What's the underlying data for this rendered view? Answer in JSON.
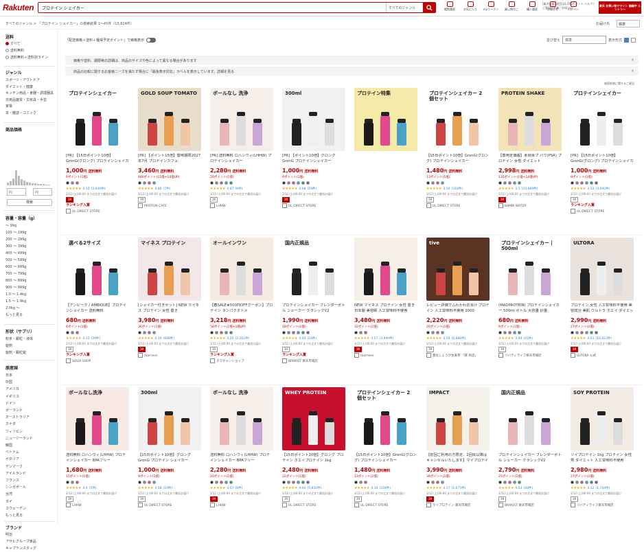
{
  "header": {
    "logo": "Rakuten",
    "search_value": "プロテイン シェイカー",
    "genre_label": "すべてのジャンル",
    "icons": [
      {
        "label": "閲覧履歴",
        "icon": "history-icon"
      },
      {
        "label": "お気に入り",
        "icon": "heart-icon"
      },
      {
        "label": "myクーポン",
        "icon": "coupon-icon"
      },
      {
        "label": "買い物かご",
        "icon": "cart-icon"
      },
      {
        "label": "購入履歴",
        "icon": "receipt-icon"
      },
      {
        "label": "お知らせ",
        "icon": "bell-icon"
      },
      {
        "label": "ログイン",
        "icon": "user-icon"
      }
    ],
    "points_text": "[楽天会員] 初回は1,000ポイント ヘルプ / ご意見目安箱 / お知らせ",
    "banner_text": "楽天 お買い物マラソン 開催中 エントリー"
  },
  "crumb": {
    "text": "すべてのジャンル > 「プロテイン シェイカー」の検索結果 1〜45件（15,624件）",
    "location": "お届け先",
    "sort_label": "標準"
  },
  "sidebar": {
    "shipping_title": "送料",
    "shipping_options": [
      "すべて",
      "送料無料",
      "送料無料＋送料別ライン"
    ],
    "genre_title": "ジャンル",
    "genres": [
      "スポーツ・アウトドア",
      "ダイエット・健康",
      "キッチン用品・食器・調理器具",
      "日用品雑貨・文房具・手芸",
      "家電",
      "本・雑誌・コミック"
    ],
    "price_title": "商品価格",
    "price_from": "円",
    "price_to": "円",
    "search_btn": "検索",
    "capacity_title": "容量・容量（g）",
    "capacities": [
      "〜 99g",
      "100 〜 199g",
      "200 〜 299g",
      "300 〜 399g",
      "400 〜 499g",
      "500 〜 599g",
      "600 〜 699g",
      "700 〜 799g",
      "800 〜 899g",
      "900 〜 999g",
      "1.0 〜 1.4kg",
      "1.5 〜 1.9kg",
      "2.0kg 〜",
      "もっと見る"
    ],
    "type_title": "形状（サプリ）",
    "types": [
      "粉末・顆粒・液体",
      "錠剤",
      "錠剤・顆粒錠"
    ],
    "origin_title": "原産国",
    "origins": [
      "日本",
      "中国",
      "アメリカ",
      "イギリス",
      "ドイツ",
      "ポーランド",
      "オーストラリア",
      "カナダ",
      "フィリピン",
      "ニュージーランド",
      "韓国",
      "ベトナム",
      "イタリア",
      "デンマーク",
      "アイルランド",
      "フランス",
      "シンガポール",
      "台湾",
      "タイ",
      "スウェーデン",
      "もっと見る"
    ],
    "brand_title": "ブランド",
    "brands": [
      "明治",
      "アサヒグループ食品",
      "キャプテンスタッグ"
    ]
  },
  "main": {
    "point_toggle_label": "「配送価格＋送料＋獲得予定ポイント」で価格表示",
    "view_label": "並び替え",
    "sort_value": "標準",
    "view_type": "表示形式",
    "notices": [
      "価格や送料、期限等の詳細は、商品のサイズや色によって異なる場合があります",
      "商品の比較に関するお客様ニーズを満たす場合に「最後表示対応」ラベルを表示しています。詳細を見る"
    ],
    "feedback": "検索結果に関するご意見"
  },
  "products": [
    {
      "title": "[PR] 【15日ポイント10倍】GronG(グロング) プロテインシェイカー",
      "price": "1,000",
      "points": "9ポイント(1倍)",
      "rating": "4.33",
      "reviews": "(3,040件)",
      "shop": "UL DIRECT STORE",
      "rank": "ランキング入賞",
      "tag": "プロテインシェイカー",
      "bg": "#ffffff"
    },
    {
      "title": "[PR] 【ポイント15倍】賞味期限2027年7月 プロテインカフェ",
      "price": "3,460",
      "points": "480ポイント(15倍+14倍UP)",
      "rating": "4.86",
      "reviews": "(7件)",
      "shop": "PROTEIN CAFE",
      "rank": "",
      "tag": "GOLD SOUP TOMATO",
      "bg": "#e8dccb"
    },
    {
      "title": "[PR] 送料無料 ロハンウィ(LHHW) プロテインシェイカー",
      "price": "2,280",
      "points": "20ポイント(1倍)",
      "rating": "4.67",
      "reviews": "(6件)",
      "shop": "LHHW",
      "rank": "",
      "tag": "ボールなし 洗浄",
      "bg": "#f6eee9"
    },
    {
      "title": "[PR] 【ポイント10倍】グロング GronG プロテインシェイカー",
      "price": "1,000",
      "points": "9ポイント(1倍)",
      "rating": "4.68",
      "reviews": "(19件)",
      "shop": "UL DIRECT STORE",
      "rank": "",
      "tag": "300ml",
      "bg": "#f1f1f1"
    },
    {
      "title": "",
      "price": "",
      "points": "",
      "rating": "",
      "reviews": "",
      "shop": "",
      "rank": "",
      "tag": "プロテイン特集",
      "bg": "#f5e9a8"
    },
    {
      "title": "【15日ポイント10倍】GronG(グロング) プロテインシェイカー",
      "price": "1,480",
      "points": "13ポイント(1倍)",
      "rating": "4.34",
      "reviews": "(318件)",
      "shop": "UL DIRECT STORE",
      "rank": "",
      "tag": "プロテインシェイカー 2個セット",
      "bg": "#ffffff"
    },
    {
      "title": "【専用定価版】未目目プ バウ(PSR) プロテイン 女性 ダイエット",
      "price": "2,998",
      "points": "135ポイント(1倍+14倍UP)",
      "rating": "4.5",
      "reviews": "(33,889件)",
      "shop": "BAMBI WATER",
      "rank": "",
      "tag": "PROTEIN SHAKE",
      "bg": "#f3e3b8"
    },
    {
      "title": "[PR] 【15日ポイント10倍】GronG(グロング) プロテインシェイカー",
      "price": "1,000",
      "points": "9ポイント(1倍)",
      "rating": "4.33",
      "reviews": "(3,040件)",
      "shop": "UL DIRECT STORE",
      "rank": "ランキング入賞",
      "tag": "プロテインシェイカー",
      "bg": "#ffffff"
    },
    {
      "title": "【アンビーク / AMBIQUE】プロテインシェイカー 送料無料",
      "price": "680",
      "points": "6ポイント(1倍)",
      "rating": "4.31",
      "reviews": "(39件)",
      "shop": "SOLIA SHOP",
      "rank": "ランキング入賞",
      "tag": "選べる2サイズ",
      "bg": "#ffffff"
    },
    {
      "title": "[シェイカー付きセット] NEW マイネス プロテイン 女性 置き",
      "price": "3,980",
      "points": "36ポイント(1倍)",
      "rating": "4.36",
      "reviews": "(668件)",
      "shop": "marness",
      "rank": "",
      "tag": "マイネス プロテイン",
      "bg": "#f3e6e6"
    },
    {
      "title": "【春SALE★500円OFFクーポン】プロテイン タンパクオトメ",
      "price": "3,218",
      "points": "58ポイント(1倍+1倍UP)",
      "rating": "4.25",
      "reviews": "(2,262件)",
      "shop": "タマチャンショップ",
      "rank": "ランキング入賞",
      "tag": "オールインワン",
      "bg": "#f4ece0"
    },
    {
      "title": "プロテインシェイカー ブレンダーボトル シェーカー クラシックV2",
      "price": "1,990",
      "points": "18ポイント(1倍)",
      "rating": "4.43",
      "reviews": "(54件)",
      "shop": "BRAKIST 楽天市場店",
      "rank": "ランキング入賞",
      "tag": "国内正規品",
      "bg": "#ffffff"
    },
    {
      "title": "NEW マイネス プロテイン 女性 置き 日本製 美容師 人工甘味料不使用",
      "price": "3,480",
      "points": "32ポイント(1倍)",
      "rating": "4.57",
      "reviews": "(3,990件)",
      "shop": "marness",
      "rank": "",
      "tag": "",
      "bg": "#f5efe8"
    },
    {
      "title": "レビュー評価でふわかわおまけ プロテイン 人工甘味料不使用 2000",
      "price": "2,220",
      "points": "20ポイント(1倍)",
      "rating": "4.56",
      "reviews": "(6,886件)",
      "shop": "豊化しょうが生姜茶 「麻 商店」",
      "rank": "",
      "tag": "tive",
      "bg": "#5a3322"
    },
    {
      "title": "(MADPROTEIN) プロテインシェイカー 500ml ボトル 大容量 計量",
      "price": "680",
      "points": "6ポイント(1倍)",
      "rating": "3.94",
      "reviews": "(41件)",
      "shop": "リバティライフ楽天市場店",
      "rank": "",
      "tag": "プロテインシェイカー | 500ml",
      "bg": "#ffffff"
    },
    {
      "title": "プロテイン 女性 人工甘味料不使用 美容成分 美肌 ウルトラ ホエイ ダイエット",
      "price": "2,990",
      "points": "27ポイント(1倍)",
      "rating": "4.61",
      "reviews": "(10,823件)",
      "shop": "ULTORA 公式",
      "rank": "",
      "tag": "ULTORA",
      "bg": "#e9e1dc"
    },
    {
      "title": "送料無料 ロハンウィ(LHHW) プロテインシェイカー BPAフリー",
      "price": "1,680",
      "points": "15ポイント(1倍)",
      "rating": "4.4",
      "reviews": "(5件)",
      "shop": "LHHW",
      "rank": "",
      "tag": "ボールなし洗浄",
      "bg": "#f7e9e3"
    },
    {
      "title": "【15日ポイント10倍】グロング GronG プロテイン シェイカー",
      "price": "1,000",
      "points": "9ポイント(1倍)",
      "rating": "4.68",
      "reviews": "(19件)",
      "shop": "UL DIRECT STORE",
      "rank": "",
      "tag": "300ml",
      "bg": "#f1f1f1"
    },
    {
      "title": "送料無料 ロハンウィ(LHHW) プロテインシェイカー BPAフリー",
      "price": "2,280",
      "points": "20ポイント(1倍)",
      "rating": "4.67",
      "reviews": "(6件)",
      "shop": "LHHW",
      "rank": "",
      "tag": "ボールなし 洗浄",
      "bg": "#f6eee9"
    },
    {
      "title": "【15日ポイント10倍】グロング プロテイン ホエイプロテイン 1kg",
      "price": "2,480",
      "points": "22ポイント(1倍)",
      "rating": "4.44",
      "reviews": "(5,830件)",
      "shop": "UL DIRECT STORE",
      "rank": "",
      "tag": "WHEY PROTEIN",
      "bg": "#c8102e"
    },
    {
      "title": "【15日ポイント10倍】GronG(グロング) プロテインシェイカー",
      "price": "1,480",
      "points": "13ポイント(1倍)",
      "rating": "4.34",
      "reviews": "(318件)",
      "shop": "UL DIRECT STORE",
      "rank": "",
      "tag": "プロテインシェイカー 2個セット",
      "bg": "#ffffff"
    },
    {
      "title": "【初回ご利用の方限定、2回目以降はキャンセルいたします】マイプロテイン",
      "price": "3,990",
      "points": "39ポイント(1倍)",
      "rating": "4.17",
      "reviews": "(1,675件)",
      "shop": "マイプロテイン 楽天市場店",
      "rank": "",
      "tag": "IMPACT",
      "bg": "#f4f0ea"
    },
    {
      "title": "プロテインシェイカー ブレンダーボトル シェーカー クラシックV2",
      "price": "2,790",
      "points": "25ポイント(1倍)",
      "rating": "4.63",
      "reviews": "(48件)",
      "shop": "BRAKIST 楽天市場店",
      "rank": "",
      "tag": "国内正規品",
      "bg": "#ffffff"
    },
    {
      "title": "ソイプロテイン 1kg プロテイン 女性 男 ダイエット 人工甘味料不使用",
      "price": "2,980",
      "points": "27ポイント(1倍)",
      "rating": "4.32",
      "reviews": "(1,744件)",
      "shop": "リバティライフ楽天市場店",
      "rank": "",
      "tag": "SOY PROTEIN",
      "bg": "#f2ece4"
    }
  ],
  "labels": {
    "free_shipping": "送料無料",
    "yen": "円",
    "shipping_note": "3/12 (土)00:00 までの注文で最短お届け"
  },
  "colors": {
    "accent": "#bf0000",
    "star": "#f4a300"
  }
}
